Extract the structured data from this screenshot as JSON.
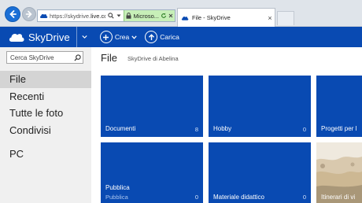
{
  "browser": {
    "url_prefix": "https://skydrive.",
    "url_host": "live.co",
    "cert_label": "Microso...",
    "tab_title": "File - SkyDrive",
    "tab_close": "×"
  },
  "header": {
    "brand": "SkyDrive",
    "create_label": "Crea",
    "upload_label": "Carica",
    "accent": "#094ab2"
  },
  "sidebar": {
    "search_placeholder": "Cerca SkyDrive",
    "items": [
      {
        "label": "File",
        "selected": true
      },
      {
        "label": "Recenti"
      },
      {
        "label": "Tutte le foto"
      },
      {
        "label": "Condivisi"
      }
    ],
    "pc_label": "PC"
  },
  "main": {
    "title": "File",
    "subtitle": "SkyDrive di Abelina",
    "tiles": [
      {
        "name": "Documenti",
        "count": "8"
      },
      {
        "name": "Hobby",
        "count": "0"
      },
      {
        "name": "Progetti per l"
      },
      {
        "name": "Pubblica",
        "sub": "Pubblica",
        "count": "0"
      },
      {
        "name": "Materiale didattico",
        "count": "0"
      },
      {
        "name": "Itinerari di vi"
      }
    ]
  }
}
